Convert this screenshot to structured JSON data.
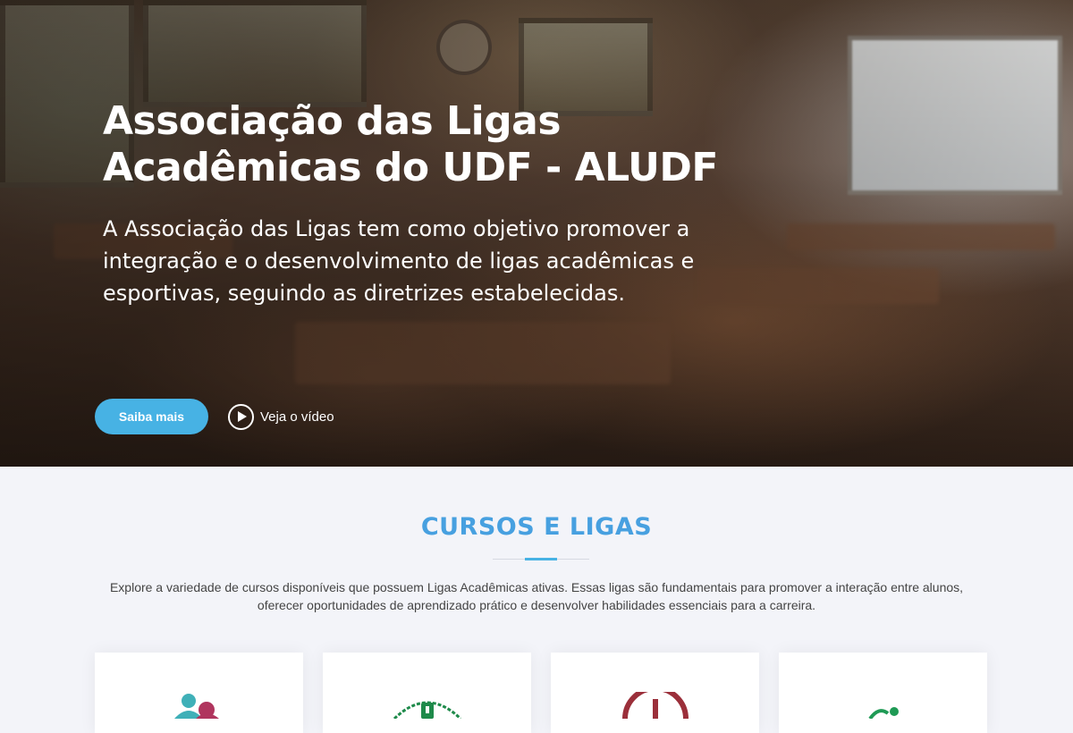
{
  "hero": {
    "title": "Associação das Ligas Acadêmicas do UDF - ALUDF",
    "subtitle": "A Associação das Ligas tem como objetivo promover a integração e o desenvolvimento de ligas acadêmicas e esportivas, seguindo as diretrizes estabelecidas.",
    "primary_button": "Saiba mais",
    "video_link": "Veja o vídeo",
    "play_icon": "play-circle-icon"
  },
  "section": {
    "title": "CURSOS E LIGAS",
    "description": "Explore a variedade de cursos disponíveis que possuem Ligas Acadêmicas ativas. Essas ligas são fundamentais para promover a interação entre alunos, oferecer oportunidades de aprendizado prático e desenvolver habilidades essenciais para a carreira.",
    "accent_color": "#47b2e4"
  },
  "cards": [
    {
      "icon": "people-logo-icon",
      "color": "#3fb0b8"
    },
    {
      "icon": "wreath-logo-icon",
      "color": "#1e8a4a"
    },
    {
      "icon": "medical-logo-icon",
      "color": "#9b2f3a"
    },
    {
      "icon": "green-logo-icon",
      "color": "#1f9a55"
    }
  ]
}
